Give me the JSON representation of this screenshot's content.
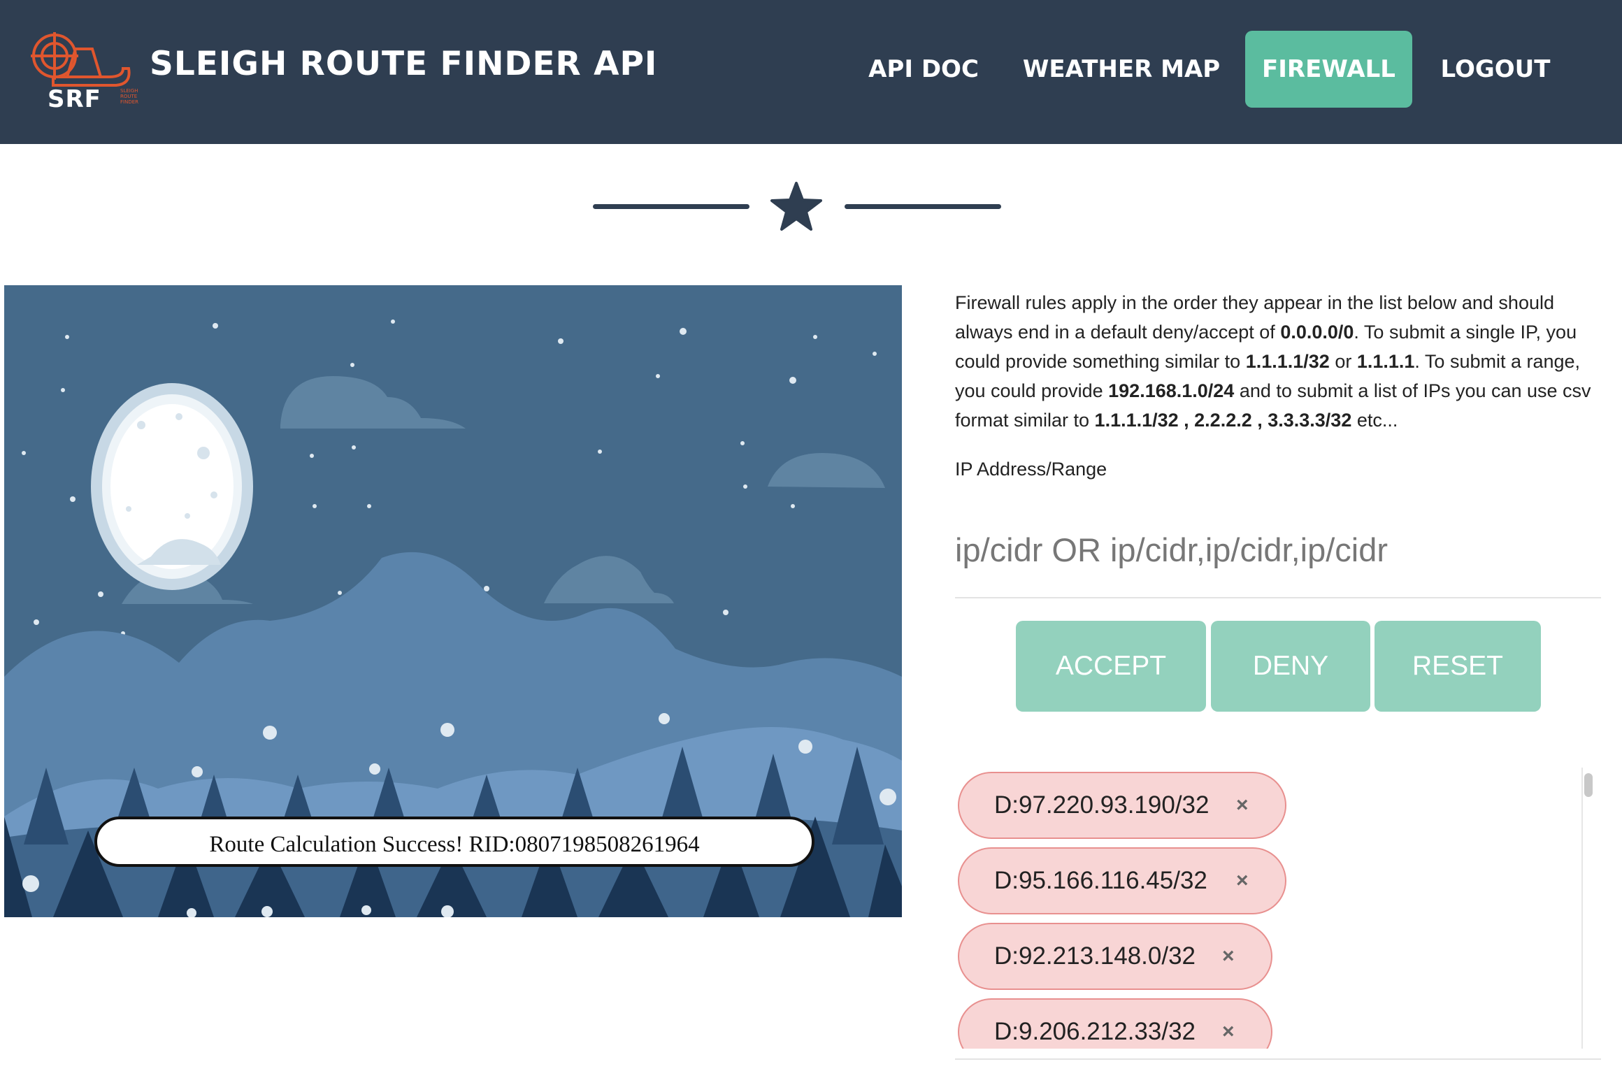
{
  "header": {
    "logo_text": "SRF",
    "logo_subtext": "SLEIGH ROUTE FINDER",
    "title": "SLEIGH ROUTE FINDER API",
    "nav": [
      {
        "label": "API DOC",
        "active": false
      },
      {
        "label": "WEATHER MAP",
        "active": false
      },
      {
        "label": "FIREWALL",
        "active": true
      },
      {
        "label": "LOGOUT",
        "active": false
      }
    ],
    "colors": {
      "bar": "#2f3e51",
      "active": "#5bbc9f",
      "logo": "#e0562e"
    }
  },
  "divider": {
    "icon": "star-icon"
  },
  "scene": {
    "toast": "Route Calculation Success! RID:0807198508261964"
  },
  "firewall": {
    "desc": {
      "t1": "Firewall rules apply in the order they appear in the list below and should always end in a default deny/accept of ",
      "b1": "0.0.0.0/0",
      "t2": ". To submit a single IP, you could provide something similar to ",
      "b2": "1.1.1.1/32",
      "t3": " or ",
      "b3": "1.1.1.1",
      "t4": ". To submit a range, you could provide ",
      "b4": "192.168.1.0/24",
      "t5": " and to submit a list of IPs you can use csv format similar to ",
      "b5": "1.1.1.1/32 , 2.2.2.2 , 3.3.3.3/32",
      "t6": " etc..."
    },
    "ip_label": "IP Address/Range",
    "ip_placeholder": "ip/cidr OR ip/cidr,ip/cidr,ip/cidr",
    "buttons": {
      "accept": "ACCEPT",
      "deny": "DENY",
      "reset": "RESET"
    },
    "rules": [
      {
        "label": "D:97.220.93.190/32"
      },
      {
        "label": "D:95.166.116.45/32"
      },
      {
        "label": "D:92.213.148.0/32"
      },
      {
        "label": "D:9.206.212.33/32"
      }
    ],
    "remove_glyph": "×",
    "colors": {
      "button": "#93d1bd",
      "rule_bg": "#f8d5d5",
      "rule_border": "#e8908f"
    }
  }
}
